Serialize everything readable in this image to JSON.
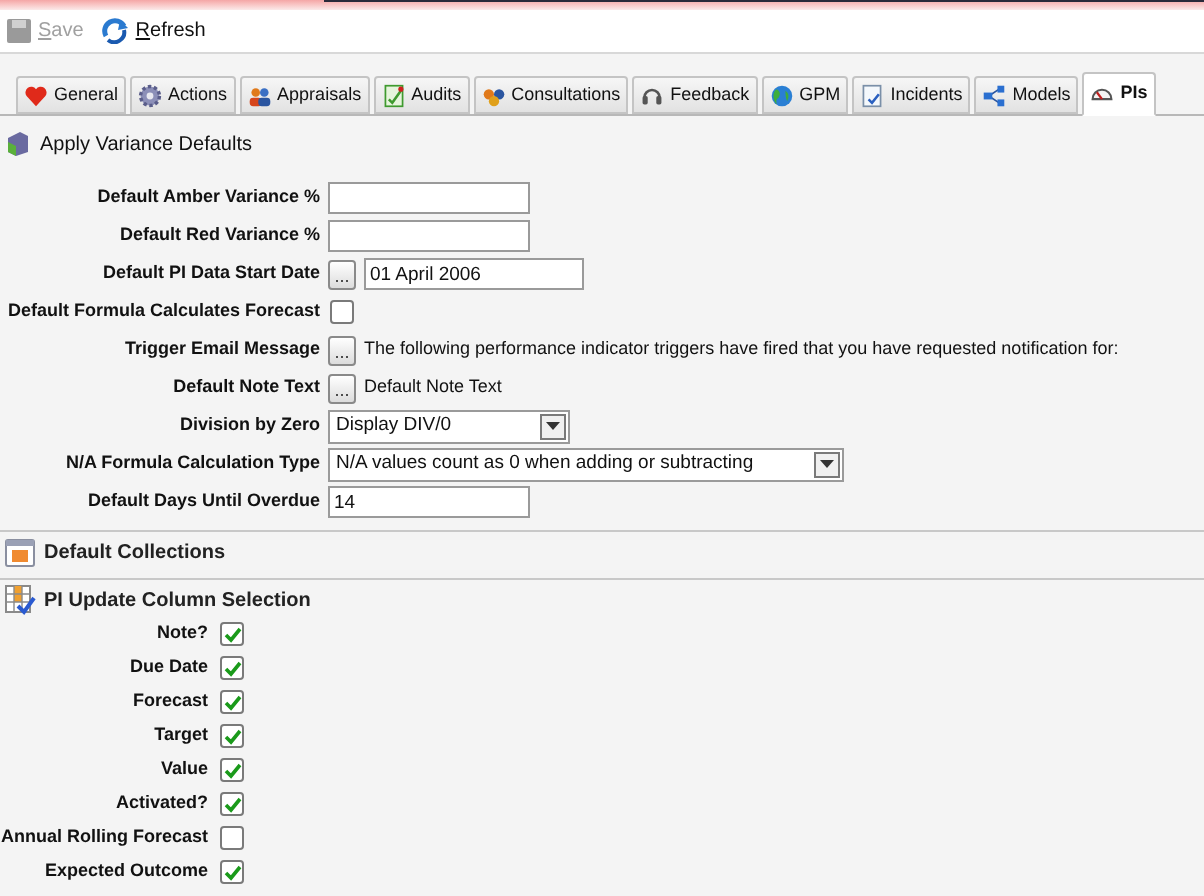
{
  "toolbar": [
    {
      "label": "Save",
      "disabled": true
    },
    {
      "label": "Refresh",
      "disabled": false
    }
  ],
  "tabs": [
    {
      "label": "General",
      "selected": false
    },
    {
      "label": "Actions",
      "selected": false
    },
    {
      "label": "Appraisals",
      "selected": false
    },
    {
      "label": "Audits",
      "selected": false
    },
    {
      "label": "Consultations",
      "selected": false
    },
    {
      "label": "Feedback",
      "selected": false
    },
    {
      "label": "GPM",
      "selected": false
    },
    {
      "label": "Incidents",
      "selected": false
    },
    {
      "label": "Models",
      "selected": false
    },
    {
      "label": "PIs",
      "selected": true
    }
  ],
  "section_variance": {
    "title": "Apply Variance Defaults"
  },
  "form": [
    {
      "kind": "text",
      "label": "Default Amber Variance %"
    },
    {
      "kind": "text",
      "label": "Default Red Variance %"
    },
    {
      "kind": "date",
      "label": "Default PI Data Start Date",
      "button": "...",
      "value": "01 April 2006"
    },
    {
      "kind": "checkbox",
      "label": "Default Formula Calculates Forecast",
      "checked": false
    },
    {
      "kind": "note",
      "label": "Trigger Email Message",
      "button": "...",
      "value": "The following performance indicator triggers have fired that you have requested notification for:"
    },
    {
      "kind": "note",
      "label": "Default Note Text",
      "button": "...",
      "value": "Default Note Text"
    },
    {
      "kind": "select",
      "label": "Division by Zero",
      "value": "Display DIV/0"
    },
    {
      "kind": "select",
      "label": "N/A Formula Calculation Type",
      "value": "N/A values count as 0 when adding or subtracting"
    },
    {
      "kind": "text",
      "label": "Default Days Until Overdue",
      "value": "14"
    }
  ],
  "section_collections": {
    "title": "Default Collections"
  },
  "section_columns": {
    "title": "PI Update Column Selection"
  },
  "columns": [
    {
      "label": "Note?",
      "checked": true
    },
    {
      "label": "Due Date",
      "checked": true
    },
    {
      "label": "Forecast",
      "checked": true
    },
    {
      "label": "Target",
      "checked": true
    },
    {
      "label": "Value",
      "checked": true
    },
    {
      "label": "Activated?",
      "checked": true
    },
    {
      "label": "Annual Rolling Forecast",
      "checked": false
    },
    {
      "label": "Expected Outcome",
      "checked": true
    }
  ]
}
